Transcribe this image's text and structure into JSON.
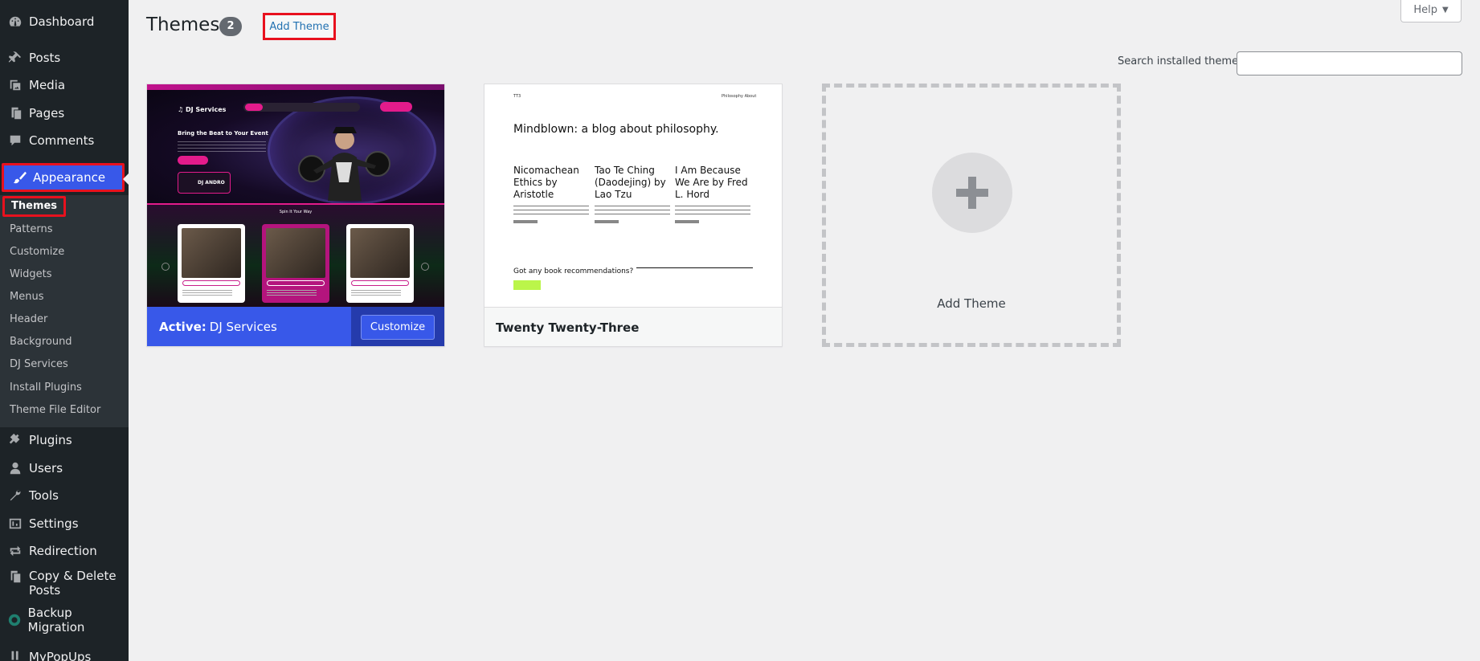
{
  "sidebar": {
    "items": [
      {
        "id": "dashboard",
        "label": "Dashboard",
        "icon": "dashboard-icon"
      },
      {
        "id": "posts",
        "label": "Posts",
        "icon": "pushpin-icon"
      },
      {
        "id": "media",
        "label": "Media",
        "icon": "media-icon"
      },
      {
        "id": "pages",
        "label": "Pages",
        "icon": "pages-icon"
      },
      {
        "id": "comments",
        "label": "Comments",
        "icon": "comment-icon"
      },
      {
        "id": "appearance",
        "label": "Appearance",
        "icon": "paintbrush-icon"
      },
      {
        "id": "plugins",
        "label": "Plugins",
        "icon": "plugin-icon"
      },
      {
        "id": "users",
        "label": "Users",
        "icon": "user-icon"
      },
      {
        "id": "tools",
        "label": "Tools",
        "icon": "wrench-icon"
      },
      {
        "id": "settings",
        "label": "Settings",
        "icon": "settings-icon"
      },
      {
        "id": "redirection",
        "label": "Redirection",
        "icon": "redirect-icon"
      },
      {
        "id": "copy-delete",
        "label": "Copy & Delete Posts",
        "icon": "copy-icon"
      },
      {
        "id": "backup-migration",
        "label": "Backup Migration",
        "icon": "backup-icon"
      },
      {
        "id": "mypopups",
        "label": "MyPopUps",
        "icon": "popup-icon"
      }
    ],
    "appearance_submenu": [
      "Themes",
      "Patterns",
      "Customize",
      "Widgets",
      "Menus",
      "Header",
      "Background",
      "DJ Services",
      "Install Plugins",
      "Theme File Editor"
    ]
  },
  "header": {
    "title": "Themes",
    "count": "2",
    "add_theme_label": "Add Theme",
    "help_label": "Help",
    "search_label": "Search installed themes",
    "search_value": "",
    "search_placeholder": ""
  },
  "themes": {
    "active": {
      "active_prefix": "Active:",
      "name": "DJ Services",
      "customize_label": "Customize",
      "preview": {
        "logo": "DJ Services",
        "hero_title": "Bring the Beat to Your Event",
        "badge": "DJ ANDRO",
        "section_title": "Spin It Your Way"
      }
    },
    "second": {
      "name": "Twenty Twenty-Three",
      "preview": {
        "logo": "TT3",
        "nav": "Philosophy   About",
        "title": "Mindblown: a blog about philosophy.",
        "posts": [
          "Nicomachean Ethics by Aristotle",
          "Tao Te Ching (Daodejing) by Lao Tzu",
          "I Am Because We Are by Fred L. Hord"
        ],
        "question": "Got any book recommendations?"
      }
    },
    "add_new_label": "Add Theme"
  },
  "colors": {
    "sidebar_bg": "#1d2327",
    "accent": "#3858e9",
    "highlight_border": "#e8111e",
    "dj_pink": "#e31b8b"
  }
}
